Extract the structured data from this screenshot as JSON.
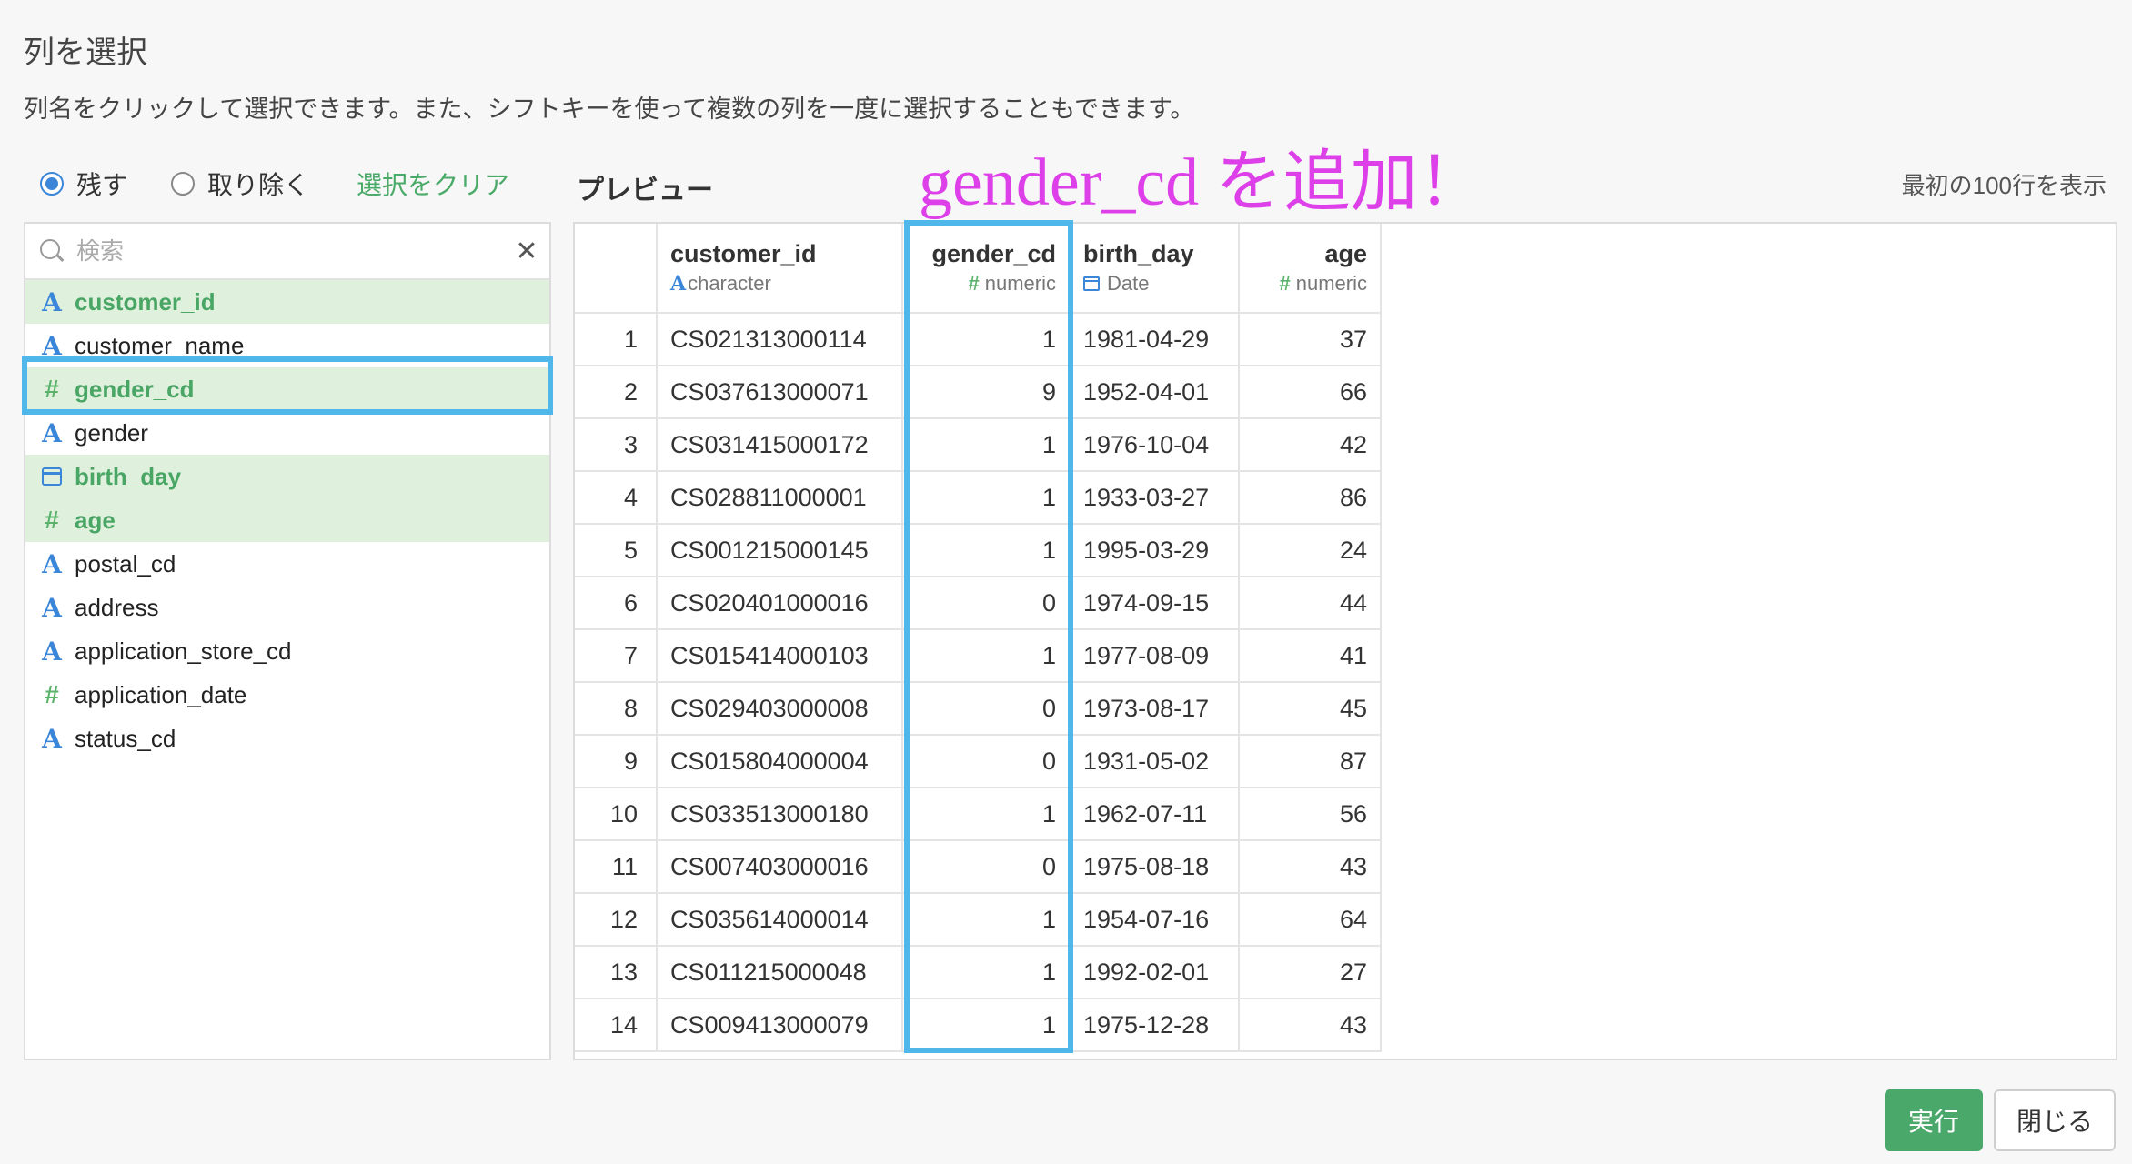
{
  "dialog": {
    "title": "列を選択",
    "description": "列名をクリックして選択できます。また、シフトキーを使って複数の列を一度に選択することもできます。"
  },
  "mode": {
    "keep_label": "残す",
    "remove_label": "取り除く",
    "selected": "keep",
    "clear_label": "選択をクリア"
  },
  "search": {
    "placeholder": "検索",
    "value": "",
    "clear_icon": "close-icon"
  },
  "columns": [
    {
      "name": "customer_id",
      "type": "character",
      "icon": "character-type-icon",
      "selected": true
    },
    {
      "name": "customer_name",
      "type": "character",
      "icon": "character-type-icon",
      "selected": false
    },
    {
      "name": "gender_cd",
      "type": "numeric",
      "icon": "numeric-type-icon",
      "selected": true
    },
    {
      "name": "gender",
      "type": "character",
      "icon": "character-type-icon",
      "selected": false
    },
    {
      "name": "birth_day",
      "type": "Date",
      "icon": "calendar-icon",
      "selected": true
    },
    {
      "name": "age",
      "type": "numeric",
      "icon": "numeric-type-icon",
      "selected": true
    },
    {
      "name": "postal_cd",
      "type": "character",
      "icon": "character-type-icon",
      "selected": false
    },
    {
      "name": "address",
      "type": "character",
      "icon": "character-type-icon",
      "selected": false
    },
    {
      "name": "application_store_cd",
      "type": "character",
      "icon": "character-type-icon",
      "selected": false
    },
    {
      "name": "application_date",
      "type": "numeric",
      "icon": "numeric-type-icon",
      "selected": false
    },
    {
      "name": "status_cd",
      "type": "character",
      "icon": "character-type-icon",
      "selected": false
    }
  ],
  "preview": {
    "label": "プレビュー",
    "row_limit": "最初の100行を表示",
    "annotation": "gender_cd を追加！",
    "headers": [
      {
        "name": "customer_id",
        "type": "character"
      },
      {
        "name": "gender_cd",
        "type": "numeric"
      },
      {
        "name": "birth_day",
        "type": "Date"
      },
      {
        "name": "age",
        "type": "numeric"
      }
    ],
    "rows": [
      [
        "1",
        "CS021313000114",
        "1",
        "1981-04-29",
        "37"
      ],
      [
        "2",
        "CS037613000071",
        "9",
        "1952-04-01",
        "66"
      ],
      [
        "3",
        "CS031415000172",
        "1",
        "1976-10-04",
        "42"
      ],
      [
        "4",
        "CS028811000001",
        "1",
        "1933-03-27",
        "86"
      ],
      [
        "5",
        "CS001215000145",
        "1",
        "1995-03-29",
        "24"
      ],
      [
        "6",
        "CS020401000016",
        "0",
        "1974-09-15",
        "44"
      ],
      [
        "7",
        "CS015414000103",
        "1",
        "1977-08-09",
        "41"
      ],
      [
        "8",
        "CS029403000008",
        "0",
        "1973-08-17",
        "45"
      ],
      [
        "9",
        "CS015804000004",
        "0",
        "1931-05-02",
        "87"
      ],
      [
        "10",
        "CS033513000180",
        "1",
        "1962-07-11",
        "56"
      ],
      [
        "11",
        "CS007403000016",
        "0",
        "1975-08-18",
        "43"
      ],
      [
        "12",
        "CS035614000014",
        "1",
        "1954-07-16",
        "64"
      ],
      [
        "13",
        "CS011215000048",
        "1",
        "1992-02-01",
        "27"
      ],
      [
        "14",
        "CS009413000079",
        "1",
        "1975-12-28",
        "43"
      ]
    ]
  },
  "buttons": {
    "run": "実行",
    "close": "閉じる"
  },
  "colors": {
    "accent_green": "#4aa86a",
    "highlight_blue": "#4fb7ea",
    "annotation_magenta": "#dd3fe8",
    "selected_bg": "#dff0dd"
  }
}
